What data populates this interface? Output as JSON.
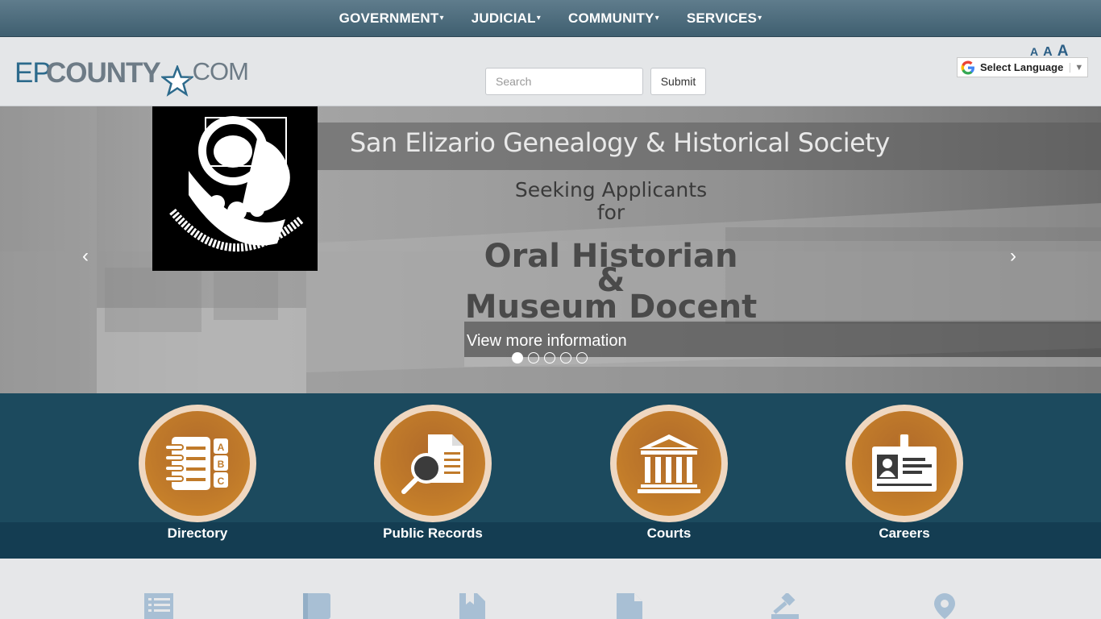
{
  "nav": {
    "items": [
      {
        "label": "GOVERNMENT"
      },
      {
        "label": "JUDICIAL"
      },
      {
        "label": "COMMUNITY"
      },
      {
        "label": "SERVICES"
      }
    ],
    "caret": "▾"
  },
  "header": {
    "logo": {
      "ep": "EP",
      "county": "COUNTY",
      "com": ".COM"
    },
    "search": {
      "placeholder": "Search",
      "value": ""
    },
    "submit_label": "Submit",
    "text_size": {
      "small": "A",
      "medium": "A",
      "large": "A"
    },
    "language_label": "Select Language",
    "language_arrow": "▼"
  },
  "carousel": {
    "title": "San Elizario Genealogy & Historical Society",
    "seeking_line1": "Seeking Applicants",
    "seeking_line2": "for",
    "role_line1": "Oral Historian",
    "role_amp": "&",
    "role_line2": "Museum Docent",
    "view_more": "View more information",
    "prev": "‹",
    "next": "›",
    "slide_count": 5,
    "active_slide": 1
  },
  "quick_links": [
    {
      "label": "Directory",
      "icon": "address-book-icon"
    },
    {
      "label": "Public Records",
      "icon": "document-search-icon"
    },
    {
      "label": "Courts",
      "icon": "courthouse-icon"
    },
    {
      "label": "Careers",
      "icon": "id-badge-icon"
    }
  ],
  "bottom_icons": [
    "list-icon",
    "book-icon",
    "bookmark-file-icon",
    "file-icon",
    "gavel-icon",
    "map-pin-icon"
  ],
  "colors": {
    "nav_bg": "#4f6f80",
    "quick_bg": "#1c4a5e",
    "quick_circle": "#c07a2a",
    "logo_blue": "#2c6a8c"
  }
}
